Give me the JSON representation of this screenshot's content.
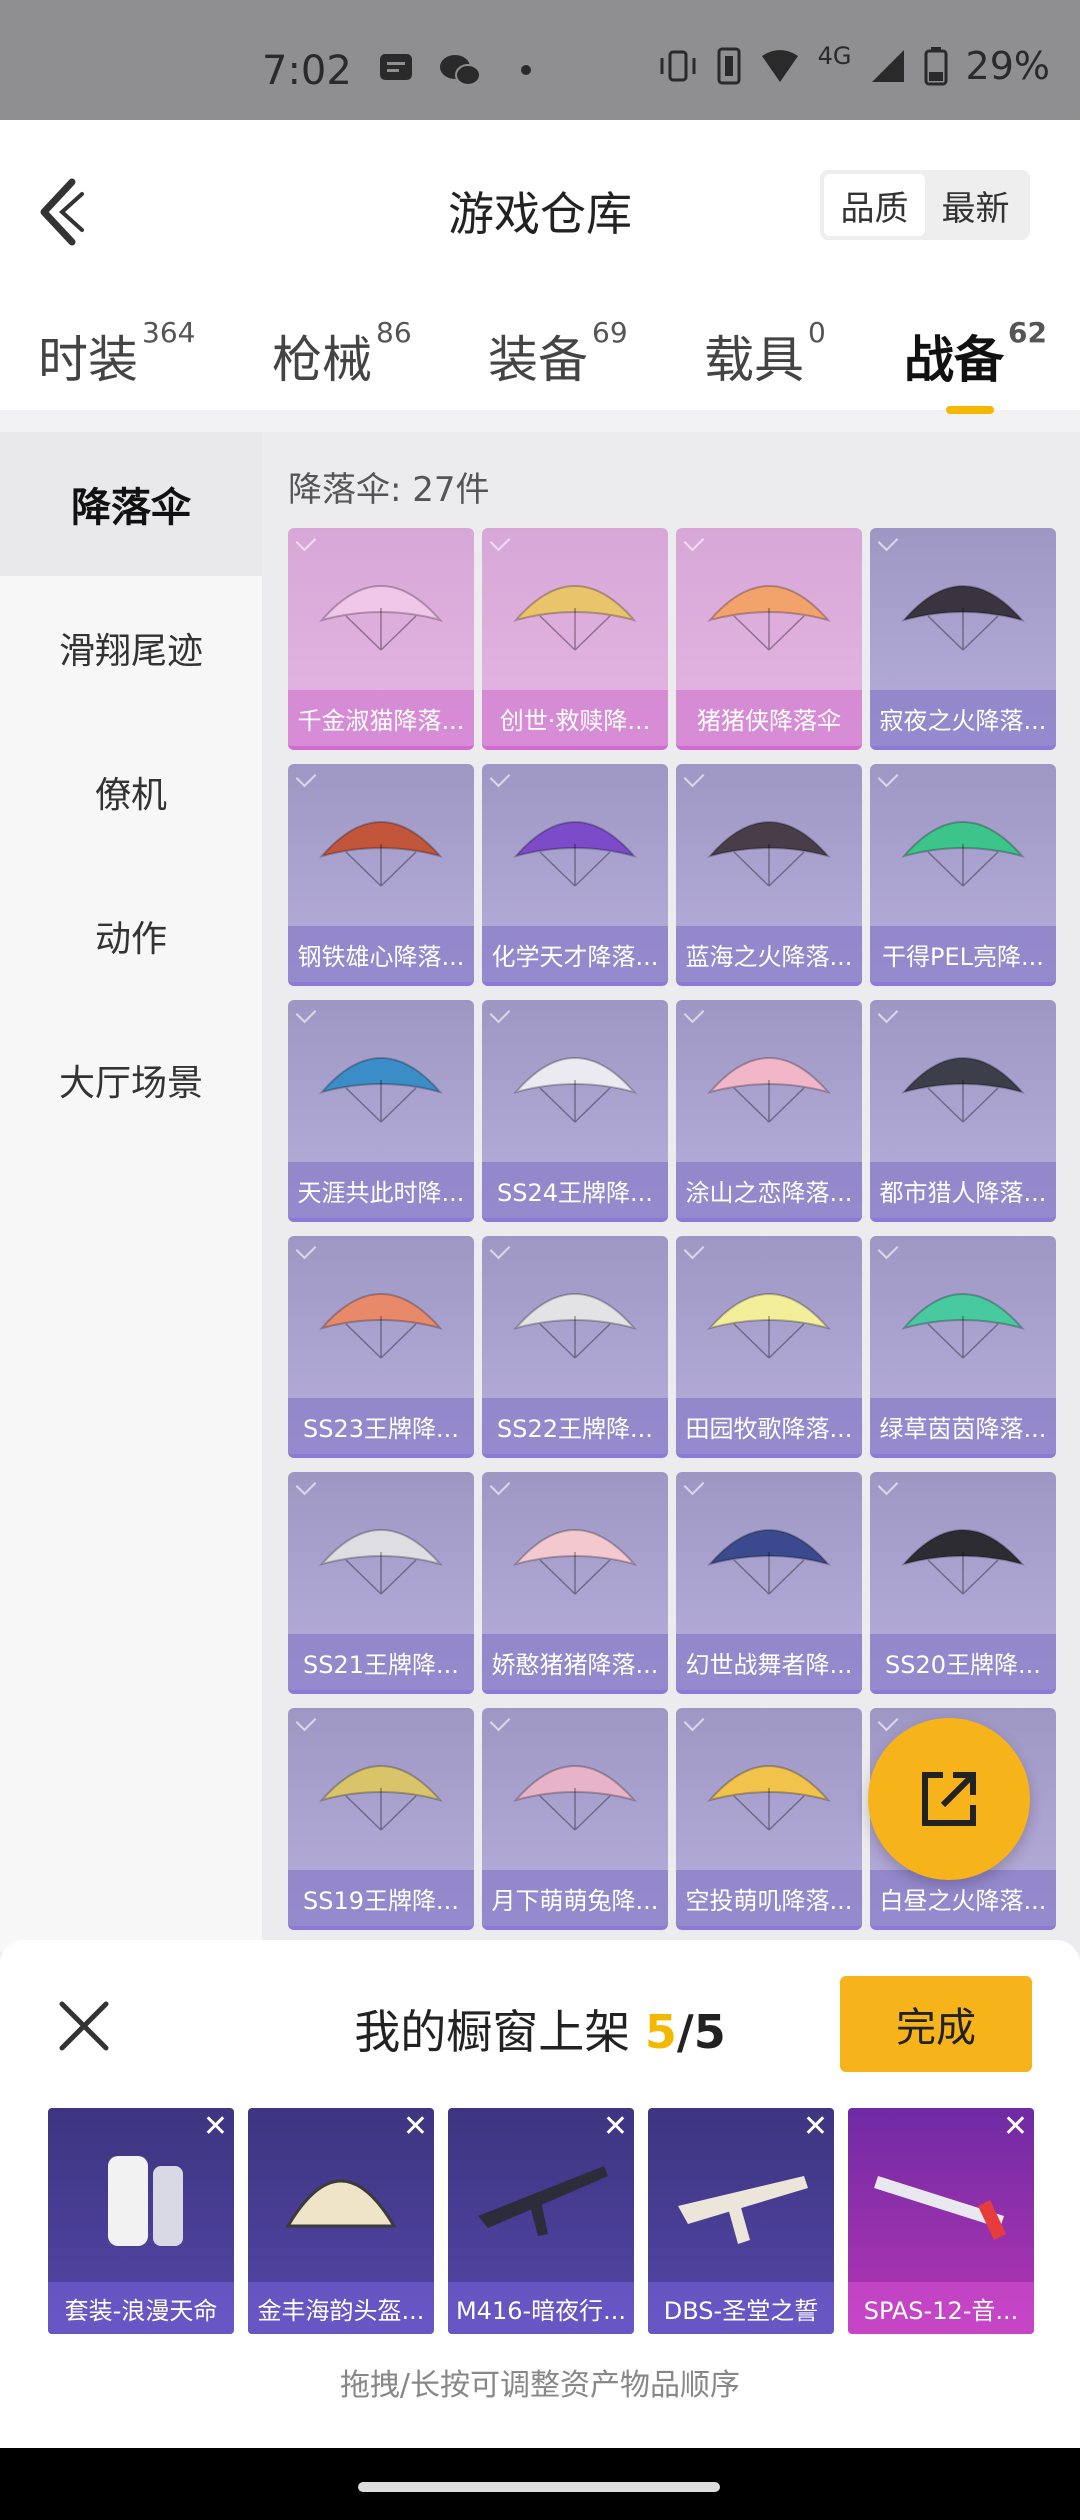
{
  "status_bar": {
    "time": "7:02",
    "network": "4G",
    "battery": "29%"
  },
  "header": {
    "title": "游戏仓库",
    "sort": {
      "quality": "品质",
      "newest": "最新",
      "selected": "品质"
    }
  },
  "tabs": [
    {
      "label": "时装",
      "count": "364"
    },
    {
      "label": "枪械",
      "count": "86"
    },
    {
      "label": "装备",
      "count": "69"
    },
    {
      "label": "载具",
      "count": "0"
    },
    {
      "label": "战备",
      "count": "62"
    }
  ],
  "sidebar": {
    "items": [
      {
        "label": "降落伞"
      },
      {
        "label": "滑翔尾迹"
      },
      {
        "label": "僚机"
      },
      {
        "label": "动作"
      },
      {
        "label": "大厅场景"
      }
    ]
  },
  "content": {
    "count_label": "降落伞: 27件",
    "items": [
      {
        "name": "千金淑猫降落...",
        "color": "#f0c7e8",
        "rarity": "pink"
      },
      {
        "name": "创世·救赎降...",
        "color": "#e9c46a",
        "rarity": "pink"
      },
      {
        "name": "猪猪侠降落伞",
        "color": "#f2a36b",
        "rarity": "pink"
      },
      {
        "name": "寂夜之火降落...",
        "color": "#3a3340",
        "rarity": "purple"
      },
      {
        "name": "钢铁雄心降落...",
        "color": "#c2563a",
        "rarity": "purple"
      },
      {
        "name": "化学天才降落...",
        "color": "#7b4bc9",
        "rarity": "purple"
      },
      {
        "name": "蓝海之火降落...",
        "color": "#4a3d4a",
        "rarity": "purple"
      },
      {
        "name": "干得PEL亮降...",
        "color": "#3dc48a",
        "rarity": "purple"
      },
      {
        "name": "天涯共此时降...",
        "color": "#3a8dc6",
        "rarity": "purple"
      },
      {
        "name": "SS24王牌降...",
        "color": "#eaeaf0",
        "rarity": "purple"
      },
      {
        "name": "涂山之恋降落...",
        "color": "#f2b6c9",
        "rarity": "purple"
      },
      {
        "name": "都市猎人降落...",
        "color": "#3c3f4a",
        "rarity": "purple"
      },
      {
        "name": "SS23王牌降...",
        "color": "#e88a6a",
        "rarity": "purple"
      },
      {
        "name": "SS22王牌降...",
        "color": "#e3e3e6",
        "rarity": "purple"
      },
      {
        "name": "田园牧歌降落...",
        "color": "#f2ee9a",
        "rarity": "purple"
      },
      {
        "name": "绿草茵茵降落...",
        "color": "#48c9a0",
        "rarity": "purple"
      },
      {
        "name": "SS21王牌降...",
        "color": "#dddde2",
        "rarity": "purple"
      },
      {
        "name": "娇憨猪猪降落...",
        "color": "#f3c9cf",
        "rarity": "purple"
      },
      {
        "name": "幻世战舞者降...",
        "color": "#3b4a8f",
        "rarity": "purple"
      },
      {
        "name": "SS20王牌降...",
        "color": "#2e2c33",
        "rarity": "purple"
      },
      {
        "name": "SS19王牌降...",
        "color": "#d9c46a",
        "rarity": "purple"
      },
      {
        "name": "月下萌萌兔降...",
        "color": "#e6b3c8",
        "rarity": "purple"
      },
      {
        "name": "空投萌叽降落...",
        "color": "#f2c34a",
        "rarity": "purple"
      },
      {
        "name": "白昼之火降落...",
        "color": "#d9d6e0",
        "rarity": "purple"
      }
    ]
  },
  "share_button": {
    "icon": "share-icon"
  },
  "showcase": {
    "title_prefix": "我的橱窗上架",
    "current": "5",
    "separator": "/",
    "total": "5",
    "done_label": "完成",
    "items": [
      {
        "name": "套装-浪漫天命",
        "rarity": "purple"
      },
      {
        "name": "金丰海韵头盔...",
        "rarity": "purple"
      },
      {
        "name": "M416-暗夜行...",
        "rarity": "purple"
      },
      {
        "name": "DBS-圣堂之誓",
        "rarity": "purple"
      },
      {
        "name": "SPAS-12-音...",
        "rarity": "pink"
      }
    ],
    "hint": "拖拽/长按可调整资产物品顺序"
  },
  "colors": {
    "accent": "#f7b31a",
    "underline": "#f5b800"
  }
}
